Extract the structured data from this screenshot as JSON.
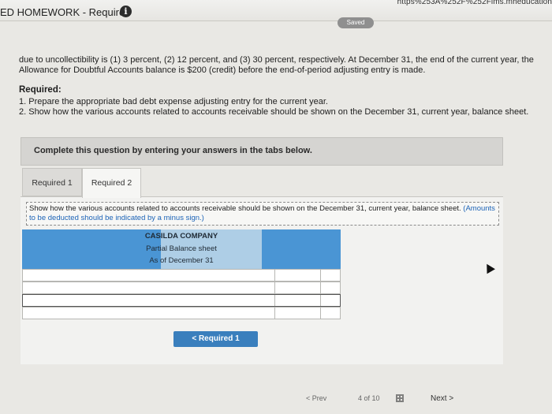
{
  "header": {
    "url_text": "https%253A%252F%252Flms.mheducation",
    "title": "ED HOMEWORK - Required",
    "info_glyph": "i",
    "saved_badge": "Saved"
  },
  "problem": {
    "paragraph": "due to uncollectibility is (1) 3 percent, (2) 12 percent, and (3) 30 percent, respectively. At December 31, the end of the current year, the Allowance for Doubtful Accounts balance is $200 (credit) before the end-of-period adjusting entry is made.",
    "required_heading": "Required:",
    "req1": "1. Prepare the appropriate bad debt expense adjusting entry for the current year.",
    "req2": "2. Show how the various accounts related to accounts receivable should be shown on the December 31, current year, balance sheet."
  },
  "complete_banner": "Complete this question by entering your answers in the tabs below.",
  "tabs": [
    {
      "label": "Required 1",
      "active": false
    },
    {
      "label": "Required 2",
      "active": true
    }
  ],
  "instruction": {
    "main": "Show how the various accounts related to accounts receivable should be shown on the December 31, current year, balance sheet.",
    "note": "(Amounts to be deducted should be indicated by a minus sign.)"
  },
  "balance_sheet": {
    "company": "CASILDA COMPANY",
    "subtitle": "Partial Balance sheet",
    "date": "As of December 31",
    "rows": [
      {
        "label": "",
        "amount": "",
        "total": ""
      },
      {
        "label": "",
        "amount": "",
        "total": ""
      },
      {
        "label": "",
        "amount": "",
        "total": ""
      },
      {
        "label": "",
        "amount": "",
        "total": ""
      }
    ]
  },
  "nav_button": "< Required 1",
  "footer": {
    "prev": "< Prev",
    "page_of": "4 of 10",
    "next": "Next >"
  },
  "colors": {
    "header_blue": "#4a95d4",
    "button_blue": "#3a7fbd",
    "note_blue": "#1c63b7"
  }
}
